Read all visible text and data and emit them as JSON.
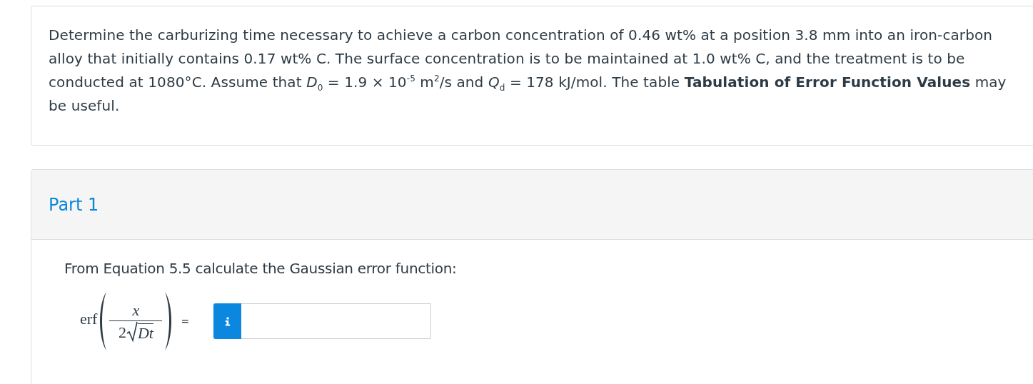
{
  "question": {
    "text": "Determine the carburizing time necessary to achieve a carbon concentration of 0.46 wt% at a position 3.8 mm into an iron-carbon alloy that initially contains 0.17 wt% C. The surface concentration is to be maintained at 1.0 wt% C, and the treatment is to be conducted at 1080°C. Assume that *D*$_{0}$ = 1.9 × 10$^{-5}$ m$^{2}$/s and *Q*$_{d}$ = 178 kJ/mol. The table **Tabulation of Error Function Values** may be useful."
  },
  "part": {
    "title": "Part 1",
    "instruction": "From Equation 5.5 calculate the Gaussian error function:",
    "equation": {
      "function": "erf",
      "numerator": "x",
      "coefficient": "2",
      "radicand": "Dt",
      "equals": "="
    }
  }
}
